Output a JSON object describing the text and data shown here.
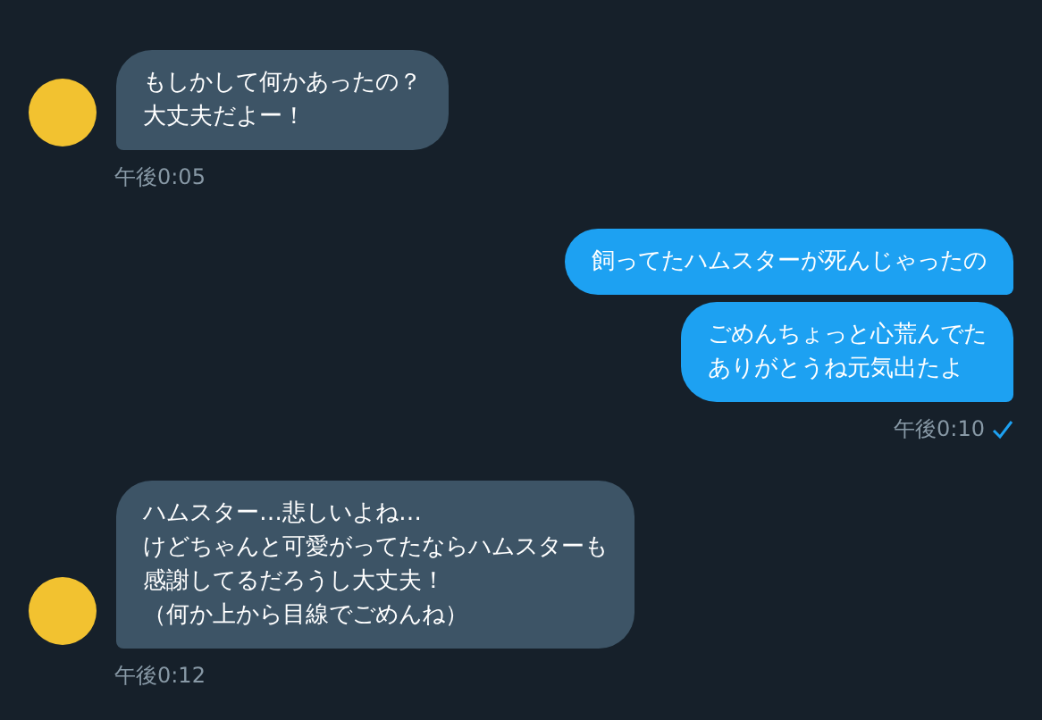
{
  "messages": [
    {
      "kind": "incoming",
      "bubbles": [
        [
          "もしかして何かあったの？",
          "大丈夫だよー！"
        ]
      ],
      "time": "午後0:05"
    },
    {
      "kind": "outgoing",
      "bubbles": [
        [
          "飼ってたハムスターが死んじゃったの"
        ],
        [
          "ごめんちょっと心荒んでた",
          "ありがとうね元気出たよ"
        ]
      ],
      "time": "午後0:10",
      "read": true
    },
    {
      "kind": "incoming",
      "bubbles": [
        [
          "ハムスター…悲しいよね…",
          "けどちゃんと可愛がってたならハムスターも",
          "感謝してるだろうし大丈夫！",
          "（何か上から目線でごめんね）"
        ]
      ],
      "time": "午後0:12"
    }
  ]
}
